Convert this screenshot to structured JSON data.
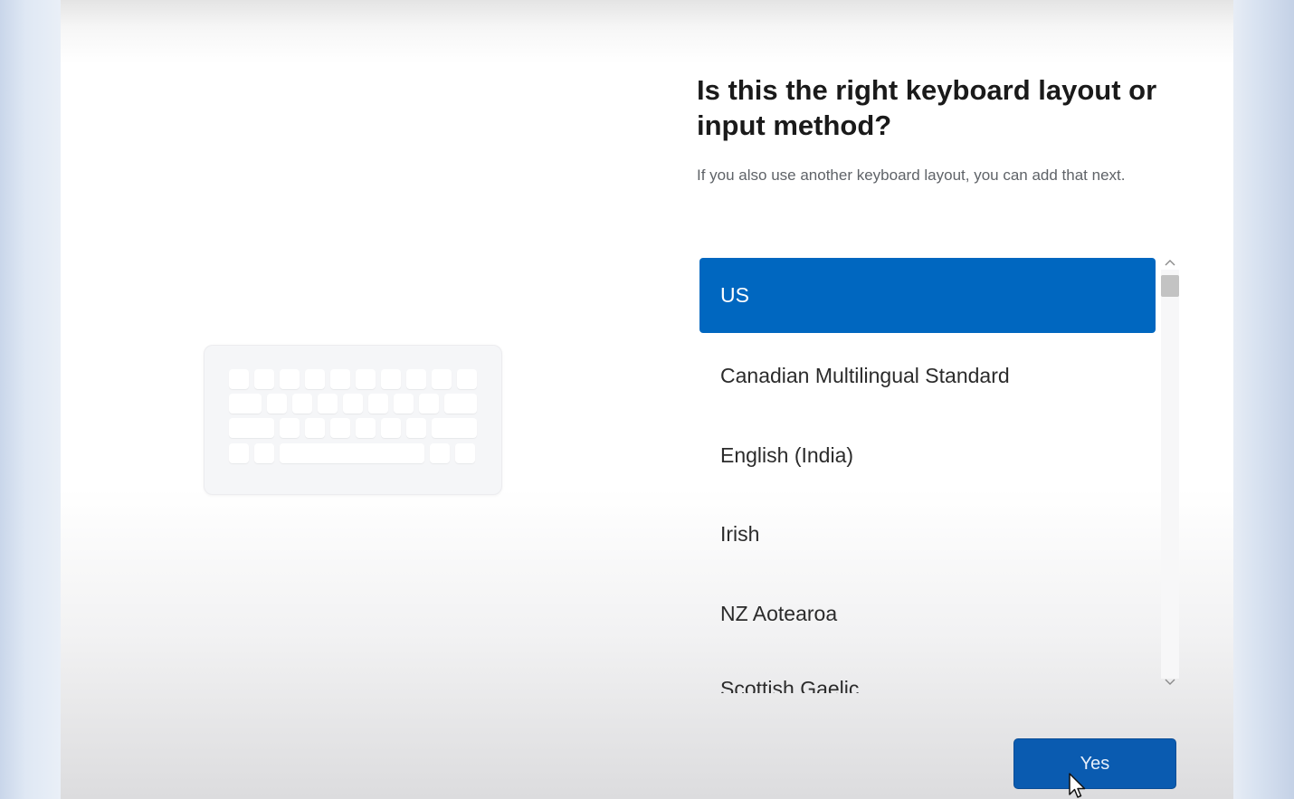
{
  "setup": {
    "title": "Is this the right keyboard layout or input method?",
    "subtitle": "If you also use another keyboard layout, you can add that next.",
    "layouts": [
      {
        "label": "US",
        "selected": true
      },
      {
        "label": "Canadian Multilingual Standard",
        "selected": false
      },
      {
        "label": "English (India)",
        "selected": false
      },
      {
        "label": "Irish",
        "selected": false
      },
      {
        "label": "NZ Aotearoa",
        "selected": false
      },
      {
        "label": "Scottish Gaelic",
        "selected": false
      }
    ],
    "primary_button_label": "Yes"
  },
  "colors": {
    "accent": "#0067c0",
    "button": "#0a5bb0"
  },
  "icons": {
    "scroll_up": "chevron-up-icon",
    "scroll_down": "chevron-down-icon",
    "illustration": "keyboard-icon",
    "pointer": "mouse-cursor-icon"
  }
}
